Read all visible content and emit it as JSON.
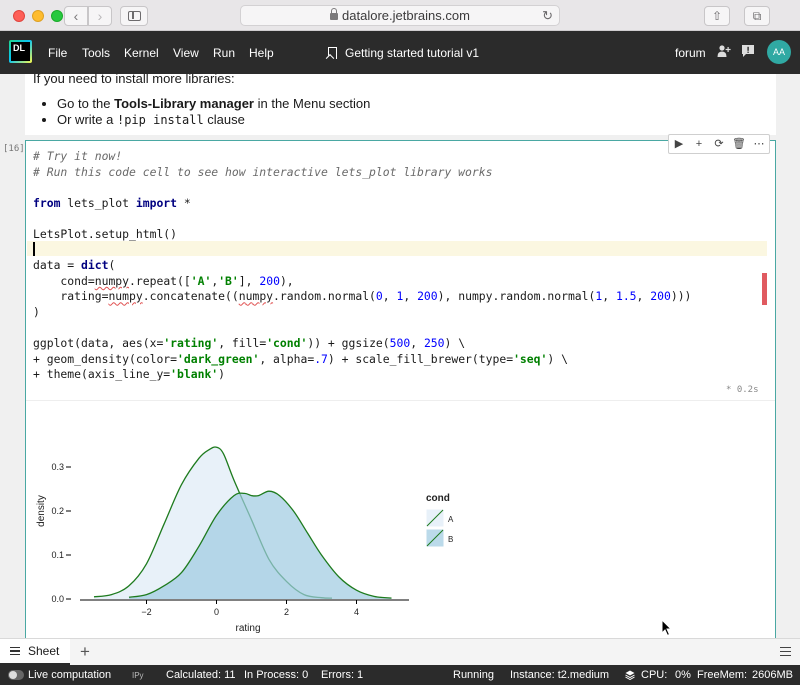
{
  "browser": {
    "url": "datalore.jetbrains.com",
    "new_tab_label": "+"
  },
  "app": {
    "logo_text": "DL",
    "menu": [
      "File",
      "Tools",
      "Kernel",
      "View",
      "Run",
      "Help"
    ],
    "notebook_title": "Getting started tutorial v1",
    "forum_label": "forum",
    "avatar_initials": "AA"
  },
  "markdown_cell": {
    "intro": "If you need to install more libraries:",
    "item1_prefix": "Go to the ",
    "item1_bold": "Tools-Library manager",
    "item1_suffix": " in the Menu section",
    "item2_prefix": "Or write a ",
    "item2_code": "!pip install",
    "item2_suffix": " clause"
  },
  "code_cell": {
    "execution_count": "[16]",
    "timing": "*  0.2s",
    "toolbar": [
      "run",
      "add",
      "restart",
      "delete",
      "more"
    ]
  },
  "chart_data": {
    "type": "area",
    "xlabel": "rating",
    "ylabel": "density",
    "xlim": [
      -3.9,
      5.5
    ],
    "ylim": [
      0,
      0.35
    ],
    "xticks": [
      -2,
      0,
      2,
      4
    ],
    "yticks": [
      0.0,
      0.1,
      0.2,
      0.3
    ],
    "xtick_labels": [
      "−2",
      "0",
      "2",
      "4"
    ],
    "ytick_labels": [
      "0.0",
      "0.1",
      "0.2",
      "0.3"
    ],
    "legend_title": "cond",
    "legend_position": "right",
    "colors": {
      "A": "#deebf7",
      "B": "#9ecae1",
      "stroke": "#1e7b1e"
    },
    "series": [
      {
        "name": "A",
        "x": [
          -3.5,
          -3.0,
          -2.5,
          -2.0,
          -1.5,
          -1.0,
          -0.5,
          -0.2,
          0.0,
          0.2,
          0.5,
          1.0,
          1.5,
          2.0,
          2.5,
          3.0,
          3.3
        ],
        "y": [
          0.005,
          0.01,
          0.03,
          0.08,
          0.17,
          0.26,
          0.32,
          0.34,
          0.345,
          0.33,
          0.27,
          0.18,
          0.09,
          0.04,
          0.01,
          0.003,
          0.002
        ]
      },
      {
        "name": "B",
        "x": [
          -2.5,
          -2.0,
          -1.5,
          -1.0,
          -0.5,
          0.0,
          0.5,
          0.8,
          1.0,
          1.2,
          1.5,
          1.8,
          2.2,
          2.6,
          3.0,
          3.5,
          4.0,
          4.5,
          5.0
        ],
        "y": [
          0.004,
          0.01,
          0.03,
          0.06,
          0.12,
          0.19,
          0.235,
          0.24,
          0.235,
          0.235,
          0.245,
          0.235,
          0.2,
          0.15,
          0.1,
          0.05,
          0.02,
          0.006,
          0.002
        ]
      }
    ]
  },
  "sheetbar": {
    "tab_label": "Sheet"
  },
  "status": {
    "live_computation": "Live computation",
    "kernel": "IPy",
    "calculated": "Calculated: 11",
    "in_process": "In Process: 0",
    "errors": "Errors: 1",
    "state": "Running",
    "instance": "Instance: t2.medium",
    "cpu": "CPU:",
    "cpu_value": "0%",
    "freemem": "FreeMem:",
    "freemem_value": "2606MB"
  }
}
